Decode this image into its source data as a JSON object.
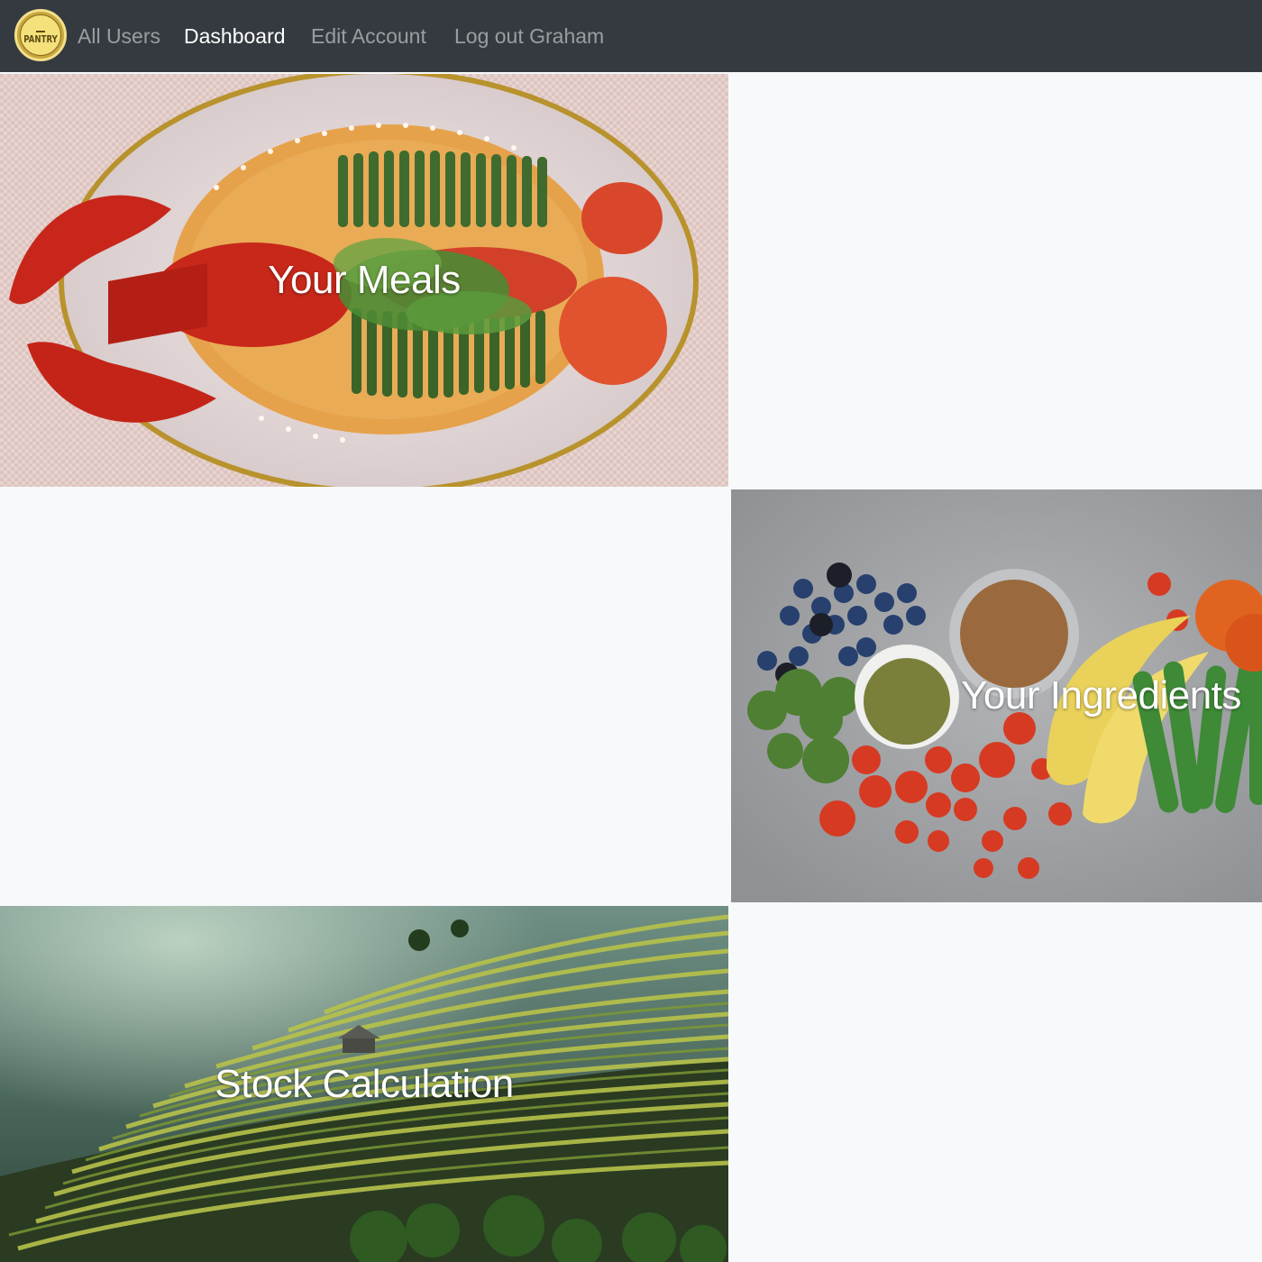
{
  "navbar": {
    "logo": {
      "text": "PANTRY",
      "icon": "pantry-logo-icon",
      "colors": {
        "ring": "#c8a73f",
        "fill": "#f5e17c"
      }
    },
    "links": [
      {
        "label": "All Users",
        "active": false
      },
      {
        "label": "Dashboard",
        "active": true
      },
      {
        "label": "Edit Account",
        "active": false
      },
      {
        "label": "Log out Graham",
        "active": false
      }
    ],
    "background": "#343a40"
  },
  "tiles": {
    "meals": {
      "title": "Your Meals",
      "image": "lobster-asparagus-dish"
    },
    "ingredients": {
      "title": "Your Ingredients",
      "image": "fresh-produce-flatlay"
    },
    "stock": {
      "title": "Stock Calculation",
      "image": "rice-terraces-landscape"
    }
  },
  "page": {
    "background": "#f8f9fa"
  }
}
